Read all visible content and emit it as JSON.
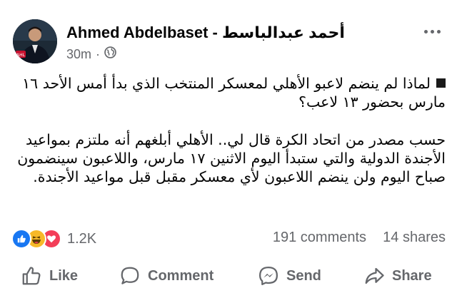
{
  "post": {
    "author": "Ahmed Abdelbaset - أحمد عبدالباسط",
    "time": "30m",
    "separator": "·",
    "privacy_icon": "globe-icon",
    "avatar_badge": "AHL",
    "paragraphs": [
      "لماذا لم ينضم لاعبو الأهلي لمعسكر المنتخب الذي بدأ أمس الأحد ١٦ مارس بحضور ١٣ لاعب؟",
      "حسب مصدر من اتحاد الكرة قال لي.. الأهلي أبلغهم أنه ملتزم بمواعيد الأجندة الدولية والتي ستبدأ اليوم الاثنين ١٧ مارس، واللاعبون سينضمون صباح اليوم ولن ينضم اللاعبون لأي معسكر مقبل قبل مواعيد الأجندة."
    ]
  },
  "stats": {
    "reactions_count": "1.2K",
    "reaction_icons": [
      "like-icon",
      "haha-icon",
      "love-icon"
    ],
    "comments": "191 comments",
    "shares": "14 shares"
  },
  "actions": {
    "like": "Like",
    "comment": "Comment",
    "send": "Send",
    "share": "Share"
  },
  "colors": {
    "text": "#050505",
    "secondary": "#65676b",
    "like_blue": "#1877f2",
    "haha_yellow": "#f7b928",
    "love_red": "#f33e58"
  }
}
